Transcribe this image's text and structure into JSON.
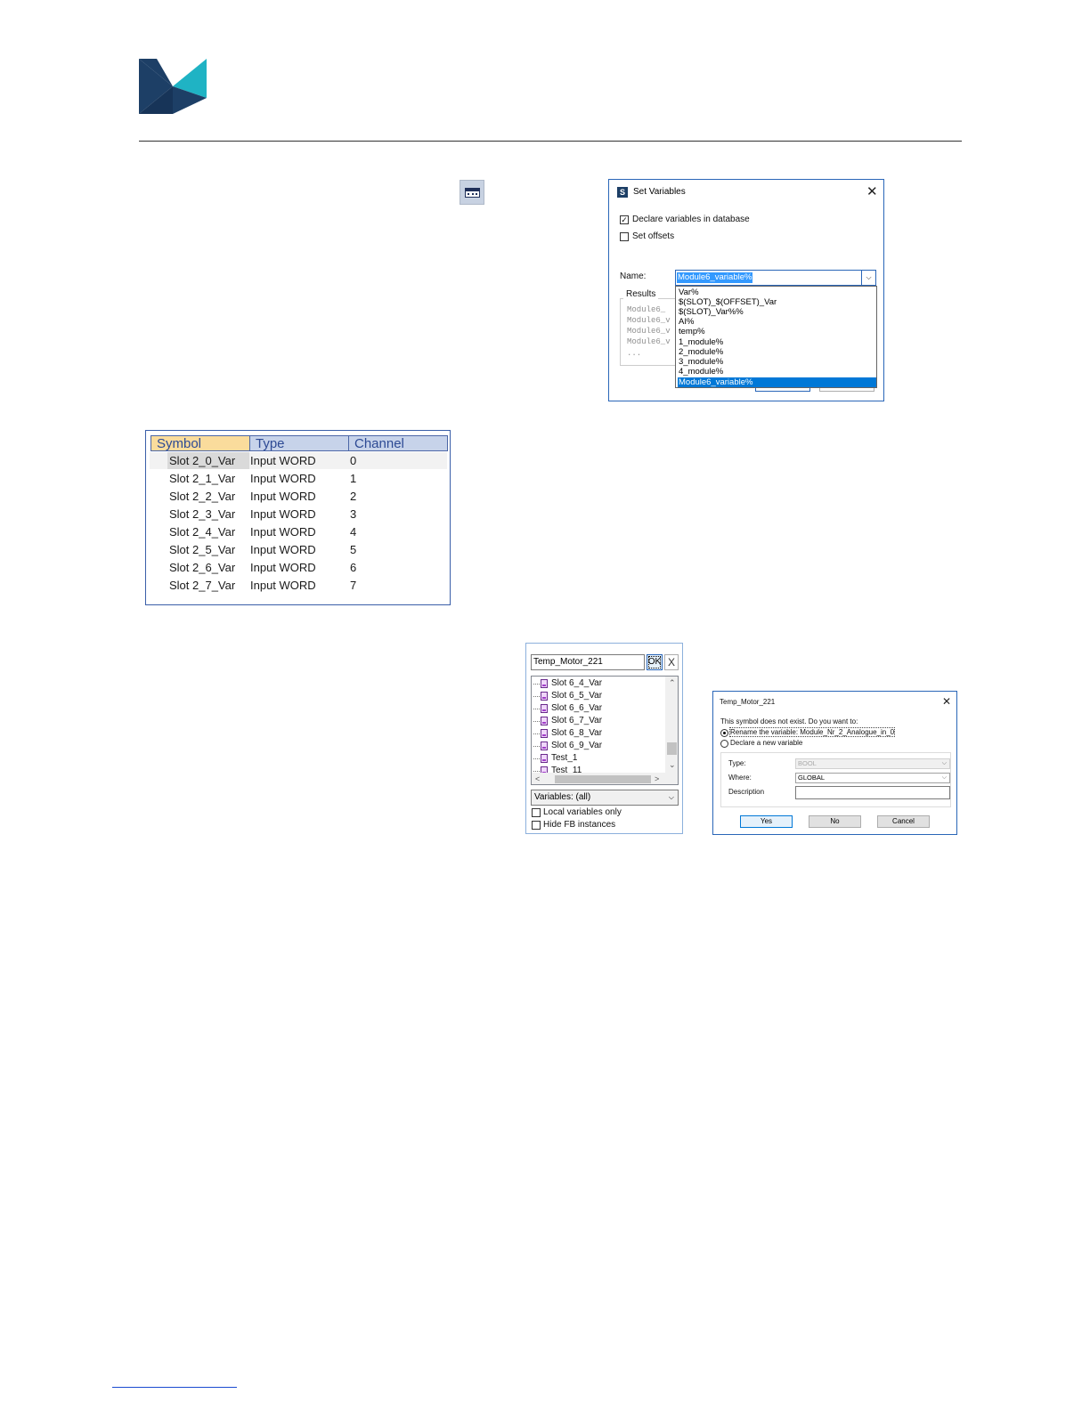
{
  "set_variables_dialog": {
    "title": "Set Variables",
    "declare_label": "Declare variables in database",
    "declare_checked": true,
    "offsets_label": "Set offsets",
    "offsets_checked": false,
    "name_label": "Name:",
    "name_value": "Module6_variable%",
    "results_label": "Results",
    "results_lines": [
      "Module6_",
      "Module6_v",
      "Module6_v",
      "Module6_v",
      "..."
    ],
    "dropdown_options": [
      "Var%",
      "$(SLOT)_$(OFFSET)_Var",
      "$(SLOT)_Var%%",
      "AI%",
      "temp%",
      "1_module%",
      "2_module%",
      "3_module%",
      "4_module%",
      "Module6_variable%"
    ],
    "dropdown_selected": "Module6_variable%"
  },
  "symbol_table": {
    "headers": [
      "Symbol",
      "Type",
      "Channel"
    ],
    "rows": [
      [
        "Slot 2_0_Var",
        "Input WORD",
        "0"
      ],
      [
        "Slot 2_1_Var",
        "Input WORD",
        "1"
      ],
      [
        "Slot 2_2_Var",
        "Input WORD",
        "2"
      ],
      [
        "Slot 2_3_Var",
        "Input WORD",
        "3"
      ],
      [
        "Slot 2_4_Var",
        "Input WORD",
        "4"
      ],
      [
        "Slot 2_5_Var",
        "Input WORD",
        "5"
      ],
      [
        "Slot 2_6_Var",
        "Input WORD",
        "6"
      ],
      [
        "Slot 2_7_Var",
        "Input WORD",
        "7"
      ]
    ]
  },
  "symbol_picker": {
    "search_value": "Temp_Motor_221",
    "ok_label": "OK",
    "cancel_label": "X",
    "items": [
      "Slot 6_4_Var",
      "Slot 6_5_Var",
      "Slot 6_6_Var",
      "Slot 6_7_Var",
      "Slot 6_8_Var",
      "Slot 6_9_Var",
      "Test_1",
      "Test_11"
    ],
    "filter_value": "Variables: (all)",
    "local_only_label": "Local variables only",
    "local_only_checked": false,
    "hide_fb_label": "Hide FB instances",
    "hide_fb_checked": false
  },
  "rename_dialog": {
    "title": "Temp_Motor_221",
    "prompt": "This symbol does not exist. Do you want to:",
    "option_rename": "Rename the variable: Module_Nr_2_Analogue_in_0",
    "option_declare": "Declare a new variable",
    "selected_option": "rename",
    "type_label": "Type:",
    "type_value": "BOOL",
    "where_label": "Where:",
    "where_value": "GLOBAL",
    "description_label": "Description",
    "description_value": "",
    "yes_label": "Yes",
    "no_label": "No",
    "cancel_label": "Cancel"
  },
  "icons": {
    "logo": "brand-bowtie-logo",
    "toolbar": "set-variables-toolbar-icon",
    "app": "app-icon",
    "variable": "variable-icon"
  },
  "colors": {
    "logo_dark": "#1d3f66",
    "logo_teal": "#1fb3c4",
    "dialog_border": "#2a66b8",
    "selection_blue": "#0078d7",
    "symbol_header": "#fadc9c",
    "column_header": "#c7d3ea"
  }
}
